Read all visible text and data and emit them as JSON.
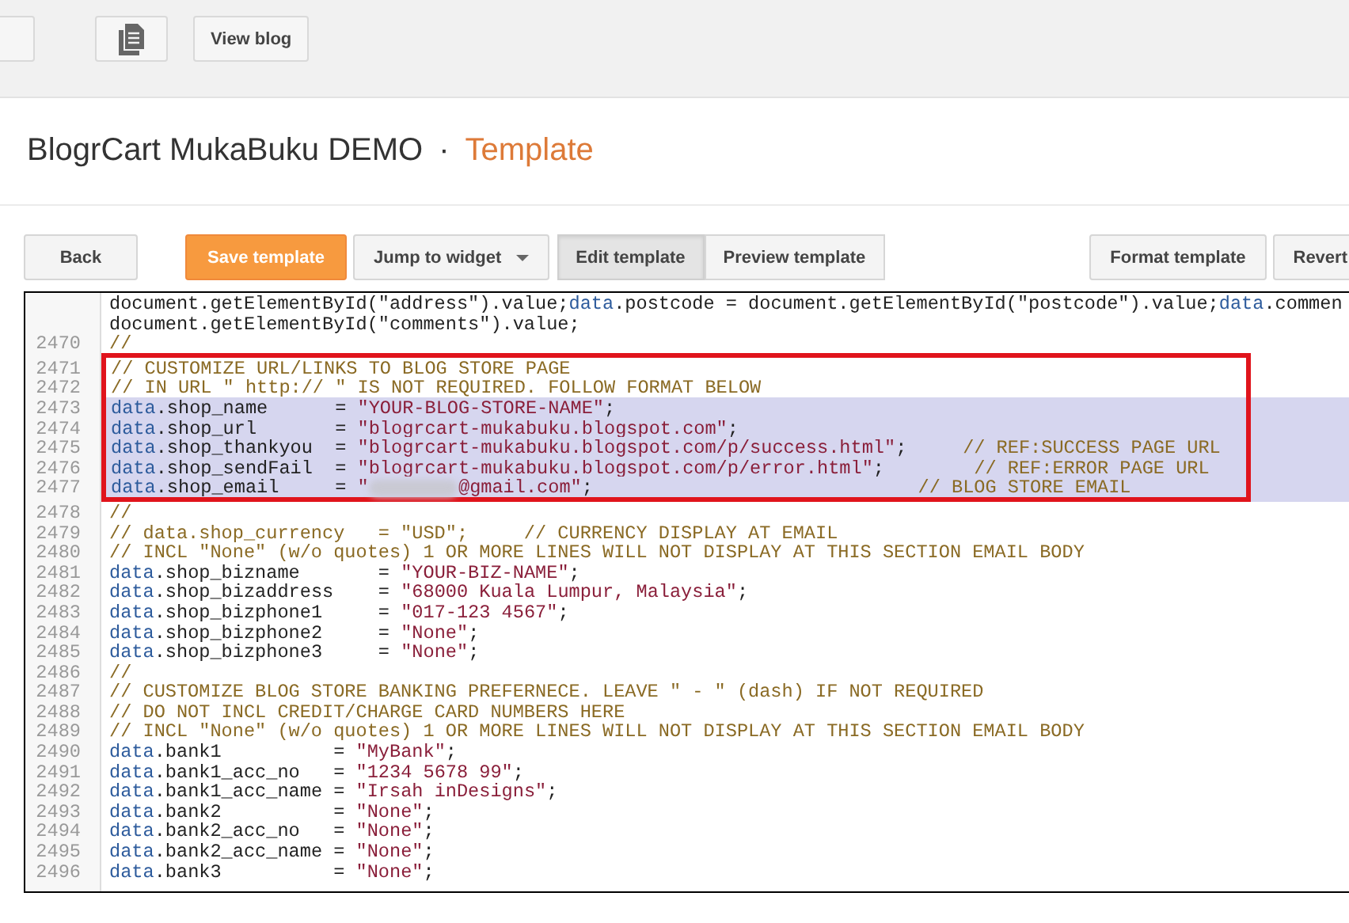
{
  "top_bar": {
    "buttons": [
      {
        "kind": "blank"
      },
      {
        "kind": "pages"
      },
      {
        "kind": "text",
        "label": "View blog"
      }
    ]
  },
  "header": {
    "blog_name": "BlogrCart MukaBuku DEMO",
    "separator": "·",
    "page": "Template"
  },
  "toolbar": {
    "left": [
      {
        "kind": "plain",
        "label": "Back"
      },
      {
        "kind": "primary",
        "label": "Save template"
      },
      {
        "kind": "dropdown",
        "label": "Jump to widget"
      }
    ],
    "modes": [
      {
        "label": "Edit template",
        "selected": true
      },
      {
        "label": "Preview template",
        "selected": false
      }
    ],
    "right": [
      {
        "kind": "plain",
        "label": "Format template"
      },
      {
        "kind": "plain",
        "label": "Revert"
      }
    ]
  },
  "editor": {
    "lines": [
      {
        "selected": false,
        "boxed": false,
        "code": [
          {
            "kind": "plain",
            "text": "document.getElementById(\"address\").value;"
          },
          {
            "kind": "kw",
            "text": "data"
          },
          {
            "kind": "plain",
            "text": ".postcode = document.getElementById(\"postcode\").value;"
          },
          {
            "kind": "kw",
            "text": "data"
          },
          {
            "kind": "plain",
            "text": ".commen"
          }
        ]
      },
      {
        "selected": false,
        "boxed": false,
        "code": [
          {
            "kind": "plain",
            "text": "document.getElementById(\"comments\").value;"
          }
        ]
      },
      {
        "number": "2470",
        "selected": false,
        "boxed": false,
        "code": [
          {
            "kind": "comment",
            "text": "//"
          }
        ]
      },
      {
        "number": "2471",
        "selected": false,
        "boxed": true,
        "code": [
          {
            "kind": "comment",
            "text": "// CUSTOMIZE URL/LINKS TO BLOG STORE PAGE"
          }
        ]
      },
      {
        "number": "2472",
        "selected": false,
        "boxed": true,
        "code": [
          {
            "kind": "comment",
            "text": "// IN URL \" http:// \" IS NOT REQUIRED. FOLLOW FORMAT BELOW"
          }
        ]
      },
      {
        "number": "2473",
        "selected": true,
        "boxed": true,
        "code": [
          {
            "kind": "kw",
            "text": "data"
          },
          {
            "kind": "plain",
            "text": ".shop_name      = "
          },
          {
            "kind": "str",
            "text": "\"YOUR-BLOG-STORE-NAME\""
          },
          {
            "kind": "plain",
            "text": ";"
          }
        ]
      },
      {
        "number": "2474",
        "selected": true,
        "boxed": true,
        "code": [
          {
            "kind": "kw",
            "text": "data"
          },
          {
            "kind": "plain",
            "text": ".shop_url       = "
          },
          {
            "kind": "str",
            "text": "\"blogrcart-mukabuku.blogspot.com\""
          },
          {
            "kind": "plain",
            "text": ";"
          }
        ]
      },
      {
        "number": "2475",
        "selected": true,
        "boxed": true,
        "code": [
          {
            "kind": "kw",
            "text": "data"
          },
          {
            "kind": "plain",
            "text": ".shop_thankyou  = "
          },
          {
            "kind": "str",
            "text": "\"blogrcart-mukabuku.blogspot.com/p/success.html\""
          },
          {
            "kind": "plain",
            "text": ";     "
          },
          {
            "kind": "comment",
            "text": "// REF:SUCCESS PAGE URL"
          }
        ]
      },
      {
        "number": "2476",
        "selected": true,
        "boxed": true,
        "code": [
          {
            "kind": "kw",
            "text": "data"
          },
          {
            "kind": "plain",
            "text": ".shop_sendFail  = "
          },
          {
            "kind": "str",
            "text": "\"blogrcart-mukabuku.blogspot.com/p/error.html\""
          },
          {
            "kind": "plain",
            "text": ";        "
          },
          {
            "kind": "comment",
            "text": "// REF:ERROR PAGE URL"
          }
        ]
      },
      {
        "number": "2477",
        "selected": true,
        "boxed": true,
        "code": [
          {
            "kind": "kw",
            "text": "data"
          },
          {
            "kind": "plain",
            "text": ".shop_email     = "
          },
          {
            "kind": "str",
            "text": "\""
          },
          {
            "kind": "redacted"
          },
          {
            "kind": "str",
            "text": "@gmail.com\""
          },
          {
            "kind": "plain",
            "text": ";                             "
          },
          {
            "kind": "comment",
            "text": "// BLOG STORE EMAIL"
          }
        ]
      },
      {
        "number": "2478",
        "selected": false,
        "boxed": false,
        "code": [
          {
            "kind": "comment",
            "text": "//"
          }
        ]
      },
      {
        "number": "2479",
        "selected": false,
        "boxed": false,
        "code": [
          {
            "kind": "comment",
            "text": "// data.shop_currency   = \"USD\";     // CURRENCY DISPLAY AT EMAIL"
          }
        ]
      },
      {
        "number": "2480",
        "selected": false,
        "boxed": false,
        "code": [
          {
            "kind": "comment",
            "text": "// INCL \"None\" (w/o quotes) 1 OR MORE LINES WILL NOT DISPLAY AT THIS SECTION EMAIL BODY"
          }
        ]
      },
      {
        "number": "2481",
        "selected": false,
        "boxed": false,
        "code": [
          {
            "kind": "kw",
            "text": "data"
          },
          {
            "kind": "plain",
            "text": ".shop_bizname       = "
          },
          {
            "kind": "str",
            "text": "\"YOUR-BIZ-NAME\""
          },
          {
            "kind": "plain",
            "text": ";"
          }
        ]
      },
      {
        "number": "2482",
        "selected": false,
        "boxed": false,
        "code": [
          {
            "kind": "kw",
            "text": "data"
          },
          {
            "kind": "plain",
            "text": ".shop_bizaddress    = "
          },
          {
            "kind": "str",
            "text": "\"68000 Kuala Lumpur, Malaysia\""
          },
          {
            "kind": "plain",
            "text": ";"
          }
        ]
      },
      {
        "number": "2483",
        "selected": false,
        "boxed": false,
        "code": [
          {
            "kind": "kw",
            "text": "data"
          },
          {
            "kind": "plain",
            "text": ".shop_bizphone1     = "
          },
          {
            "kind": "str",
            "text": "\"017-123 4567\""
          },
          {
            "kind": "plain",
            "text": ";"
          }
        ]
      },
      {
        "number": "2484",
        "selected": false,
        "boxed": false,
        "code": [
          {
            "kind": "kw",
            "text": "data"
          },
          {
            "kind": "plain",
            "text": ".shop_bizphone2     = "
          },
          {
            "kind": "str",
            "text": "\"None\""
          },
          {
            "kind": "plain",
            "text": ";"
          }
        ]
      },
      {
        "number": "2485",
        "selected": false,
        "boxed": false,
        "code": [
          {
            "kind": "kw",
            "text": "data"
          },
          {
            "kind": "plain",
            "text": ".shop_bizphone3     = "
          },
          {
            "kind": "str",
            "text": "\"None\""
          },
          {
            "kind": "plain",
            "text": ";"
          }
        ]
      },
      {
        "number": "2486",
        "selected": false,
        "boxed": false,
        "code": [
          {
            "kind": "comment",
            "text": "//"
          }
        ]
      },
      {
        "number": "2487",
        "selected": false,
        "boxed": false,
        "code": [
          {
            "kind": "comment",
            "text": "// CUSTOMIZE BLOG STORE BANKING PREFERNECE. LEAVE \" - \" (dash) IF NOT REQUIRED"
          }
        ]
      },
      {
        "number": "2488",
        "selected": false,
        "boxed": false,
        "code": [
          {
            "kind": "comment",
            "text": "// DO NOT INCL CREDIT/CHARGE CARD NUMBERS HERE"
          }
        ]
      },
      {
        "number": "2489",
        "selected": false,
        "boxed": false,
        "code": [
          {
            "kind": "comment",
            "text": "// INCL \"None\" (w/o quotes) 1 OR MORE LINES WILL NOT DISPLAY AT THIS SECTION EMAIL BODY"
          }
        ]
      },
      {
        "number": "2490",
        "selected": false,
        "boxed": false,
        "code": [
          {
            "kind": "kw",
            "text": "data"
          },
          {
            "kind": "plain",
            "text": ".bank1          = "
          },
          {
            "kind": "str",
            "text": "\"MyBank\""
          },
          {
            "kind": "plain",
            "text": ";"
          }
        ]
      },
      {
        "number": "2491",
        "selected": false,
        "boxed": false,
        "code": [
          {
            "kind": "kw",
            "text": "data"
          },
          {
            "kind": "plain",
            "text": ".bank1_acc_no   = "
          },
          {
            "kind": "str",
            "text": "\"1234 5678 99\""
          },
          {
            "kind": "plain",
            "text": ";"
          }
        ]
      },
      {
        "number": "2492",
        "selected": false,
        "boxed": false,
        "code": [
          {
            "kind": "kw",
            "text": "data"
          },
          {
            "kind": "plain",
            "text": ".bank1_acc_name = "
          },
          {
            "kind": "str",
            "text": "\"Irsah inDesigns\""
          },
          {
            "kind": "plain",
            "text": ";"
          }
        ]
      },
      {
        "number": "2493",
        "selected": false,
        "boxed": false,
        "code": [
          {
            "kind": "kw",
            "text": "data"
          },
          {
            "kind": "plain",
            "text": ".bank2          = "
          },
          {
            "kind": "str",
            "text": "\"None\""
          },
          {
            "kind": "plain",
            "text": ";"
          }
        ]
      },
      {
        "number": "2494",
        "selected": false,
        "boxed": false,
        "code": [
          {
            "kind": "kw",
            "text": "data"
          },
          {
            "kind": "plain",
            "text": ".bank2_acc_no   = "
          },
          {
            "kind": "str",
            "text": "\"None\""
          },
          {
            "kind": "plain",
            "text": ";"
          }
        ]
      },
      {
        "number": "2495",
        "selected": false,
        "boxed": false,
        "code": [
          {
            "kind": "kw",
            "text": "data"
          },
          {
            "kind": "plain",
            "text": ".bank2_acc_name = "
          },
          {
            "kind": "str",
            "text": "\"None\""
          },
          {
            "kind": "plain",
            "text": ";"
          }
        ]
      },
      {
        "number": "2496",
        "selected": false,
        "boxed": false,
        "code": [
          {
            "kind": "kw",
            "text": "data"
          },
          {
            "kind": "plain",
            "text": ".bank3          = "
          },
          {
            "kind": "str",
            "text": "\"None\""
          },
          {
            "kind": "plain",
            "text": ";"
          }
        ]
      }
    ]
  }
}
